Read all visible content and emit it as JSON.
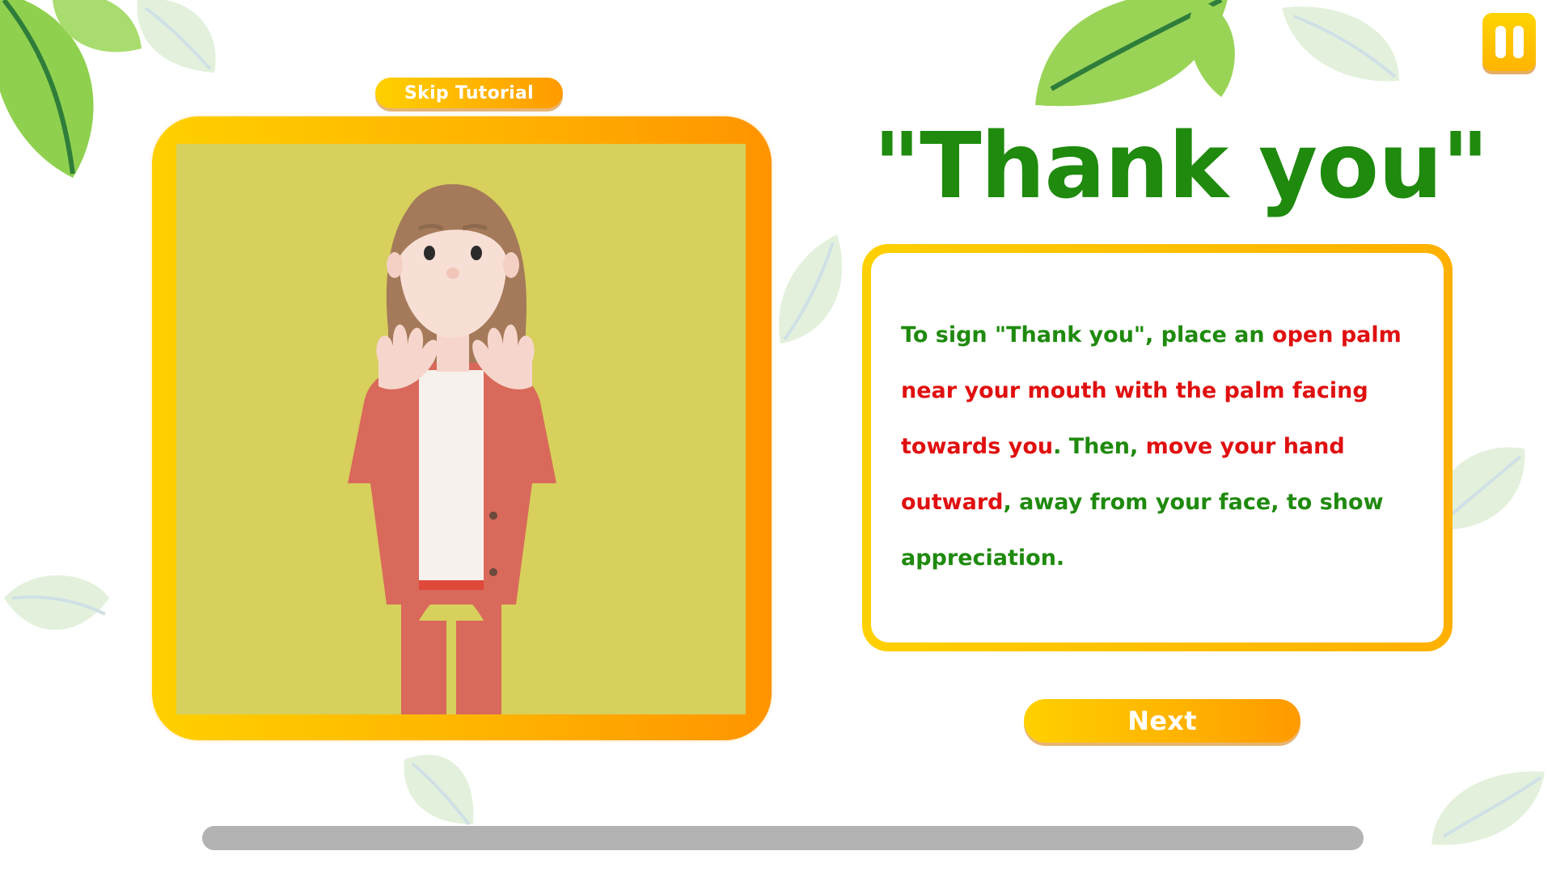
{
  "colors": {
    "accent_yellow": "#ffc000",
    "title_green": "#1f8a0e",
    "highlight_red": "#e01010",
    "video_bg": "#d7d05c",
    "progress_track": "#b3b3b3"
  },
  "header": {
    "skip_label": "Skip Tutorial",
    "pause_icon": "pause-icon"
  },
  "lesson": {
    "word": "\"Thank you\"",
    "description_segments": [
      {
        "text": "To sign \"Thank you\", place an ",
        "highlight": false
      },
      {
        "text": "open palm near your mouth with the palm facing towards you",
        "highlight": true
      },
      {
        "text": ". Then, ",
        "highlight": false
      },
      {
        "text": "move your hand outward",
        "highlight": true
      },
      {
        "text": ", away from your face, to show appreciation.",
        "highlight": false
      }
    ]
  },
  "footer": {
    "next_label": "Next"
  },
  "decorations": [
    "leaf-icon"
  ]
}
